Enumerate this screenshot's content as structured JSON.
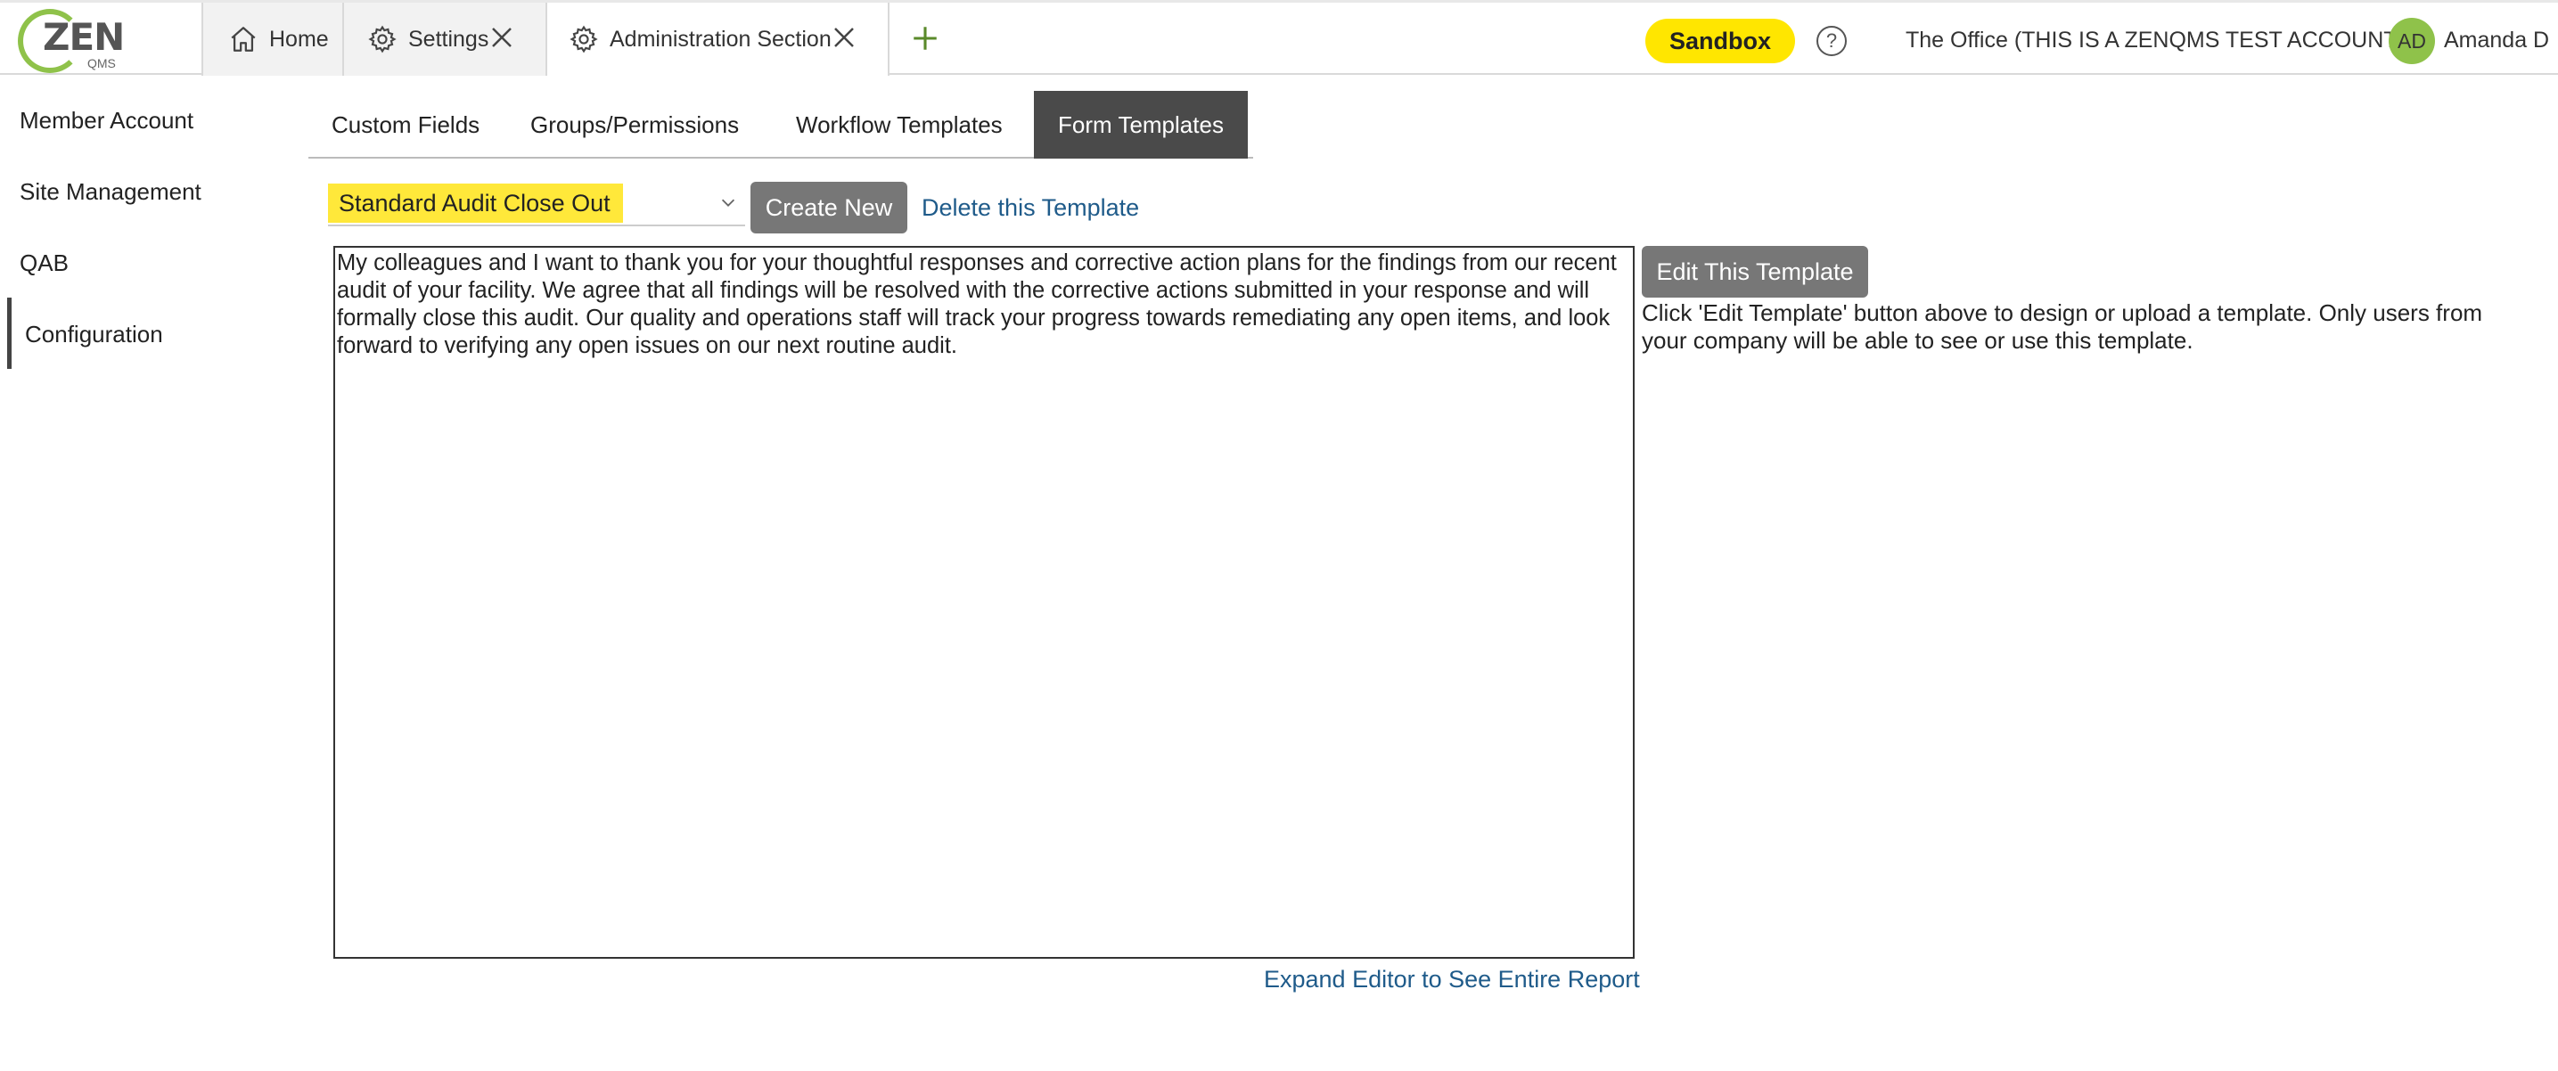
{
  "header": {
    "logo_text": "ZEN",
    "logo_sub": "QMS",
    "tabs": [
      {
        "label": "Home",
        "icon": "home-icon"
      },
      {
        "label": "Settings",
        "icon": "gear-icon",
        "closable": true
      },
      {
        "label": "Administration Section",
        "icon": "gear-icon",
        "closable": true,
        "active": true
      }
    ],
    "sandbox_label": "Sandbox",
    "help_label": "?",
    "account_name": "The Office (THIS IS A ZENQMS TEST ACCOUNT)",
    "avatar_initials": "AD",
    "user_name": "Amanda D",
    "colors": {
      "accent_green": "#8fc24a",
      "sandbox_yellow": "#ffe600"
    }
  },
  "sidebar": {
    "items": [
      {
        "label": "Member Account"
      },
      {
        "label": "Site Management"
      },
      {
        "label": "QAB"
      },
      {
        "label": "Configuration",
        "active": true
      }
    ]
  },
  "subtabs": [
    {
      "label": "Custom Fields"
    },
    {
      "label": "Groups/Permissions"
    },
    {
      "label": "Workflow Templates"
    },
    {
      "label": "Form Templates",
      "active": true
    }
  ],
  "template": {
    "selected": "Standard Audit Close Out",
    "create_label": "Create New",
    "delete_label": "Delete this Template",
    "body": "My colleagues and I want to thank you for your thoughtful responses and corrective action plans for the findings from our recent audit of your facility. We agree that all findings will be resolved with the corrective actions submitted in your response and will formally close this audit. Our quality and operations staff will track your progress towards remediating any open items, and look forward to verifying any open issues on our next routine audit.",
    "edit_label": "Edit This Template",
    "edit_help": "Click 'Edit Template' button above to design or upload a template. Only users from your company will be able to see or use this template.",
    "expand_label": "Expand Editor to See Entire Report"
  }
}
